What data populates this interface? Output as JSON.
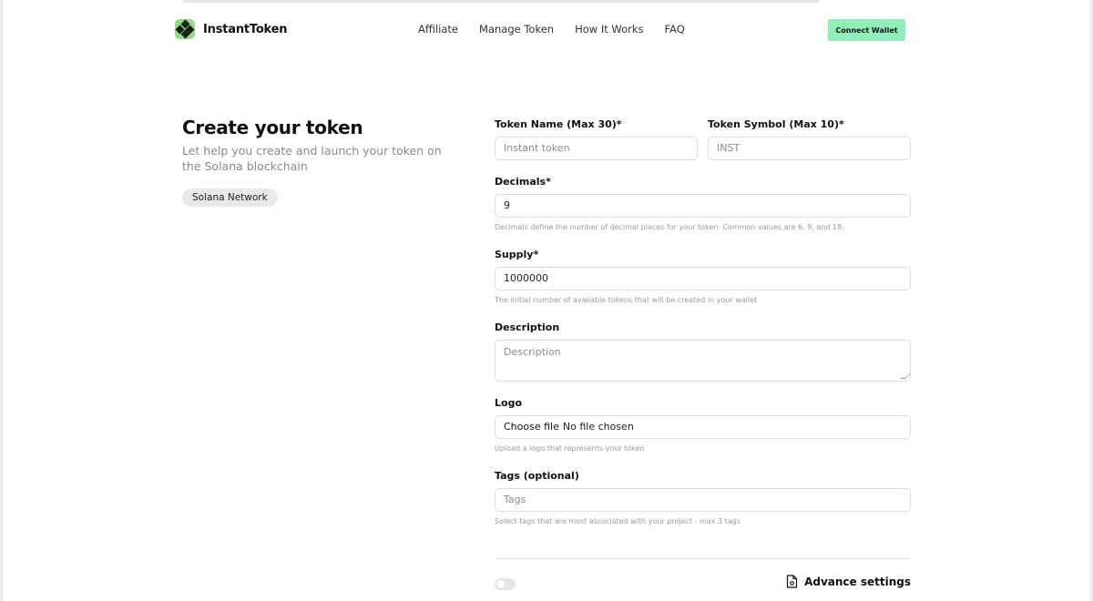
{
  "header": {
    "brand": "InstantToken",
    "nav": [
      "Affiliate",
      "Manage Token",
      "How It Works",
      "FAQ"
    ],
    "connect_label": "Connect Wallet"
  },
  "intro": {
    "title": "Create your token",
    "subtitle": "Let help you create and launch your token on the Solana blockchain",
    "network": "Solana Network"
  },
  "form": {
    "token_name": {
      "label": "Token Name (Max 30)*",
      "placeholder": "Instant token",
      "value": ""
    },
    "token_symbol": {
      "label": "Token Symbol (Max 10)*",
      "placeholder": "INST",
      "value": ""
    },
    "decimals": {
      "label": "Decimals*",
      "value": "9",
      "hint": "Decimals define the number of decimal places for your token. Common values are 6, 9, and 18."
    },
    "supply": {
      "label": "Supply*",
      "value": "1000000",
      "hint": "The initial number of available tokens that will be created in your wallet"
    },
    "description": {
      "label": "Description",
      "placeholder": "Description"
    },
    "logo": {
      "label": "Logo",
      "button": "Choose file",
      "status": "No file chosen",
      "hint": "Upload a logo that represents your token"
    },
    "tags": {
      "label": "Tags (optional)",
      "placeholder": "Tags",
      "hint": "Select tags that are most associated with your project - max 3 tags"
    },
    "advance_label": "Advance settings",
    "advance_toggle_on": false
  },
  "icons": {
    "logo": "diamond-grid-icon",
    "advance": "file-settings-icon"
  },
  "colors": {
    "accent": "#8ef0b8",
    "logo_bg": "#8ee07f"
  }
}
